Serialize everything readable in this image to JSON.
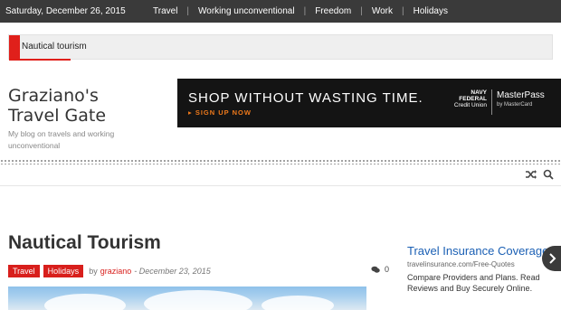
{
  "topbar": {
    "date": "Saturday, December 26, 2015",
    "nav": [
      "Travel",
      "Working unconventional",
      "Freedom",
      "Work",
      "Holidays"
    ]
  },
  "ticker": {
    "text": "Nautical tourism"
  },
  "brand": {
    "title_line1": "Graziano's",
    "title_line2": "Travel Gate",
    "tagline": "My blog on travels and working unconventional"
  },
  "ad_banner": {
    "headline": "SHOP WITHOUT WASTING TIME.",
    "cta": "▸ SIGN UP NOW",
    "logo1_line1": "NAVY",
    "logo1_line2": "FEDERAL",
    "logo1_line3": "Credit Union",
    "logo2": "MasterPass",
    "logo2_sub": "by MasterCard"
  },
  "toolbar": {
    "icons": [
      "shuffle-icon",
      "search-icon"
    ]
  },
  "post": {
    "title": "Nautical Tourism",
    "tags": [
      "Travel",
      "Holidays"
    ],
    "by": "by",
    "author": "graziano",
    "date": "- December 23, 2015",
    "comment_count": "0"
  },
  "side_ad": {
    "title": "Travel Insurance Coverage",
    "url": "travelinsurance.com/Free-Quotes",
    "desc": "Compare Providers and Plans. Read Reviews and Buy Securely Online."
  },
  "colors": {
    "accent": "#d81f1c",
    "topbar": "#3a3a3a",
    "ad_bg": "#141414",
    "link": "#1a5fb4"
  }
}
